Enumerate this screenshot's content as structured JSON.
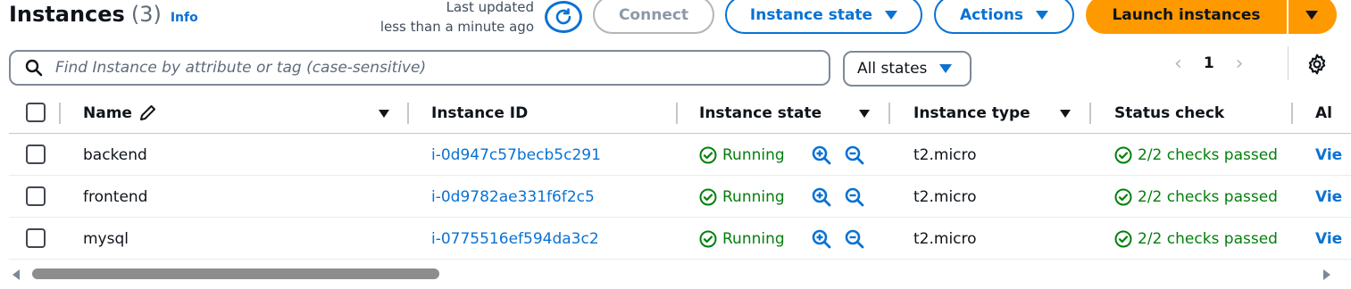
{
  "header": {
    "title": "Instances",
    "count": "(3)",
    "info": "Info",
    "last_updated_line1": "Last updated",
    "last_updated_line2": "less than a minute ago"
  },
  "toolbar": {
    "connect": "Connect",
    "instance_state": "Instance state",
    "actions": "Actions",
    "launch": "Launch instances"
  },
  "filter": {
    "search_placeholder": "Find Instance by attribute or tag (case-sensitive)",
    "states_value": "All states"
  },
  "pagination": {
    "prev": "‹",
    "page": "1",
    "next": "›"
  },
  "table": {
    "columns": [
      "Name",
      "Instance ID",
      "Instance state",
      "Instance type",
      "Status check",
      "Al"
    ],
    "rows": [
      {
        "name": "backend",
        "id": "i-0d947c57becb5c291",
        "state": "Running",
        "type": "t2.micro",
        "status": "2/2 checks passed",
        "alarm": "View alarms"
      },
      {
        "name": "frontend",
        "id": "i-0d9782ae331f6f2c5",
        "state": "Running",
        "type": "t2.micro",
        "status": "2/2 checks passed",
        "alarm": "View alarms"
      },
      {
        "name": "mysql",
        "id": "i-0775516ef594da3c2",
        "state": "Running",
        "type": "t2.micro",
        "status": "2/2 checks passed",
        "alarm": "View alarms"
      }
    ]
  },
  "colors": {
    "accent": "#0972d3",
    "primary": "#ff9900",
    "success": "#037f0c",
    "disabled": "#8d99a8"
  },
  "icons": {
    "refresh": "refresh-icon",
    "search": "search-icon",
    "edit": "pencil-icon",
    "settings": "gear-icon",
    "running": "check-circle-icon",
    "zoom_in": "zoom-in-icon",
    "zoom_out": "zoom-out-icon"
  }
}
